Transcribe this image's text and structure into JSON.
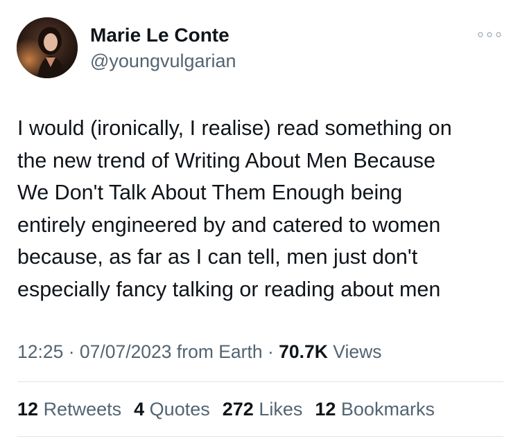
{
  "author": {
    "name": "Marie Le Conte",
    "handle": "@youngvulgarian"
  },
  "tweet": {
    "lines": [
      "I would (ironically, I realise) read something on",
      "the new trend of Writing About Men Because",
      "We Don't Talk About Them Enough being",
      "entirely engineered by and catered to women",
      "because, as far as I can tell, men just don't",
      "especially fancy talking or reading about men"
    ]
  },
  "meta": {
    "time": "12:25",
    "separator1": " · ",
    "date": "07/07/2023",
    "source": " from Earth",
    "separator2": " · ",
    "views_count": "70.7K",
    "views_label": " Views"
  },
  "stats": {
    "retweets": {
      "count": "12",
      "label": "Retweets"
    },
    "quotes": {
      "count": "4",
      "label": "Quotes"
    },
    "likes": {
      "count": "272",
      "label": "Likes"
    },
    "bookmarks": {
      "count": "12",
      "label": "Bookmarks"
    }
  },
  "icons": {
    "more": "more-dots-icon"
  },
  "colors": {
    "text_primary": "#0f1419",
    "text_secondary": "#536471",
    "divider": "#dfe4e8"
  }
}
